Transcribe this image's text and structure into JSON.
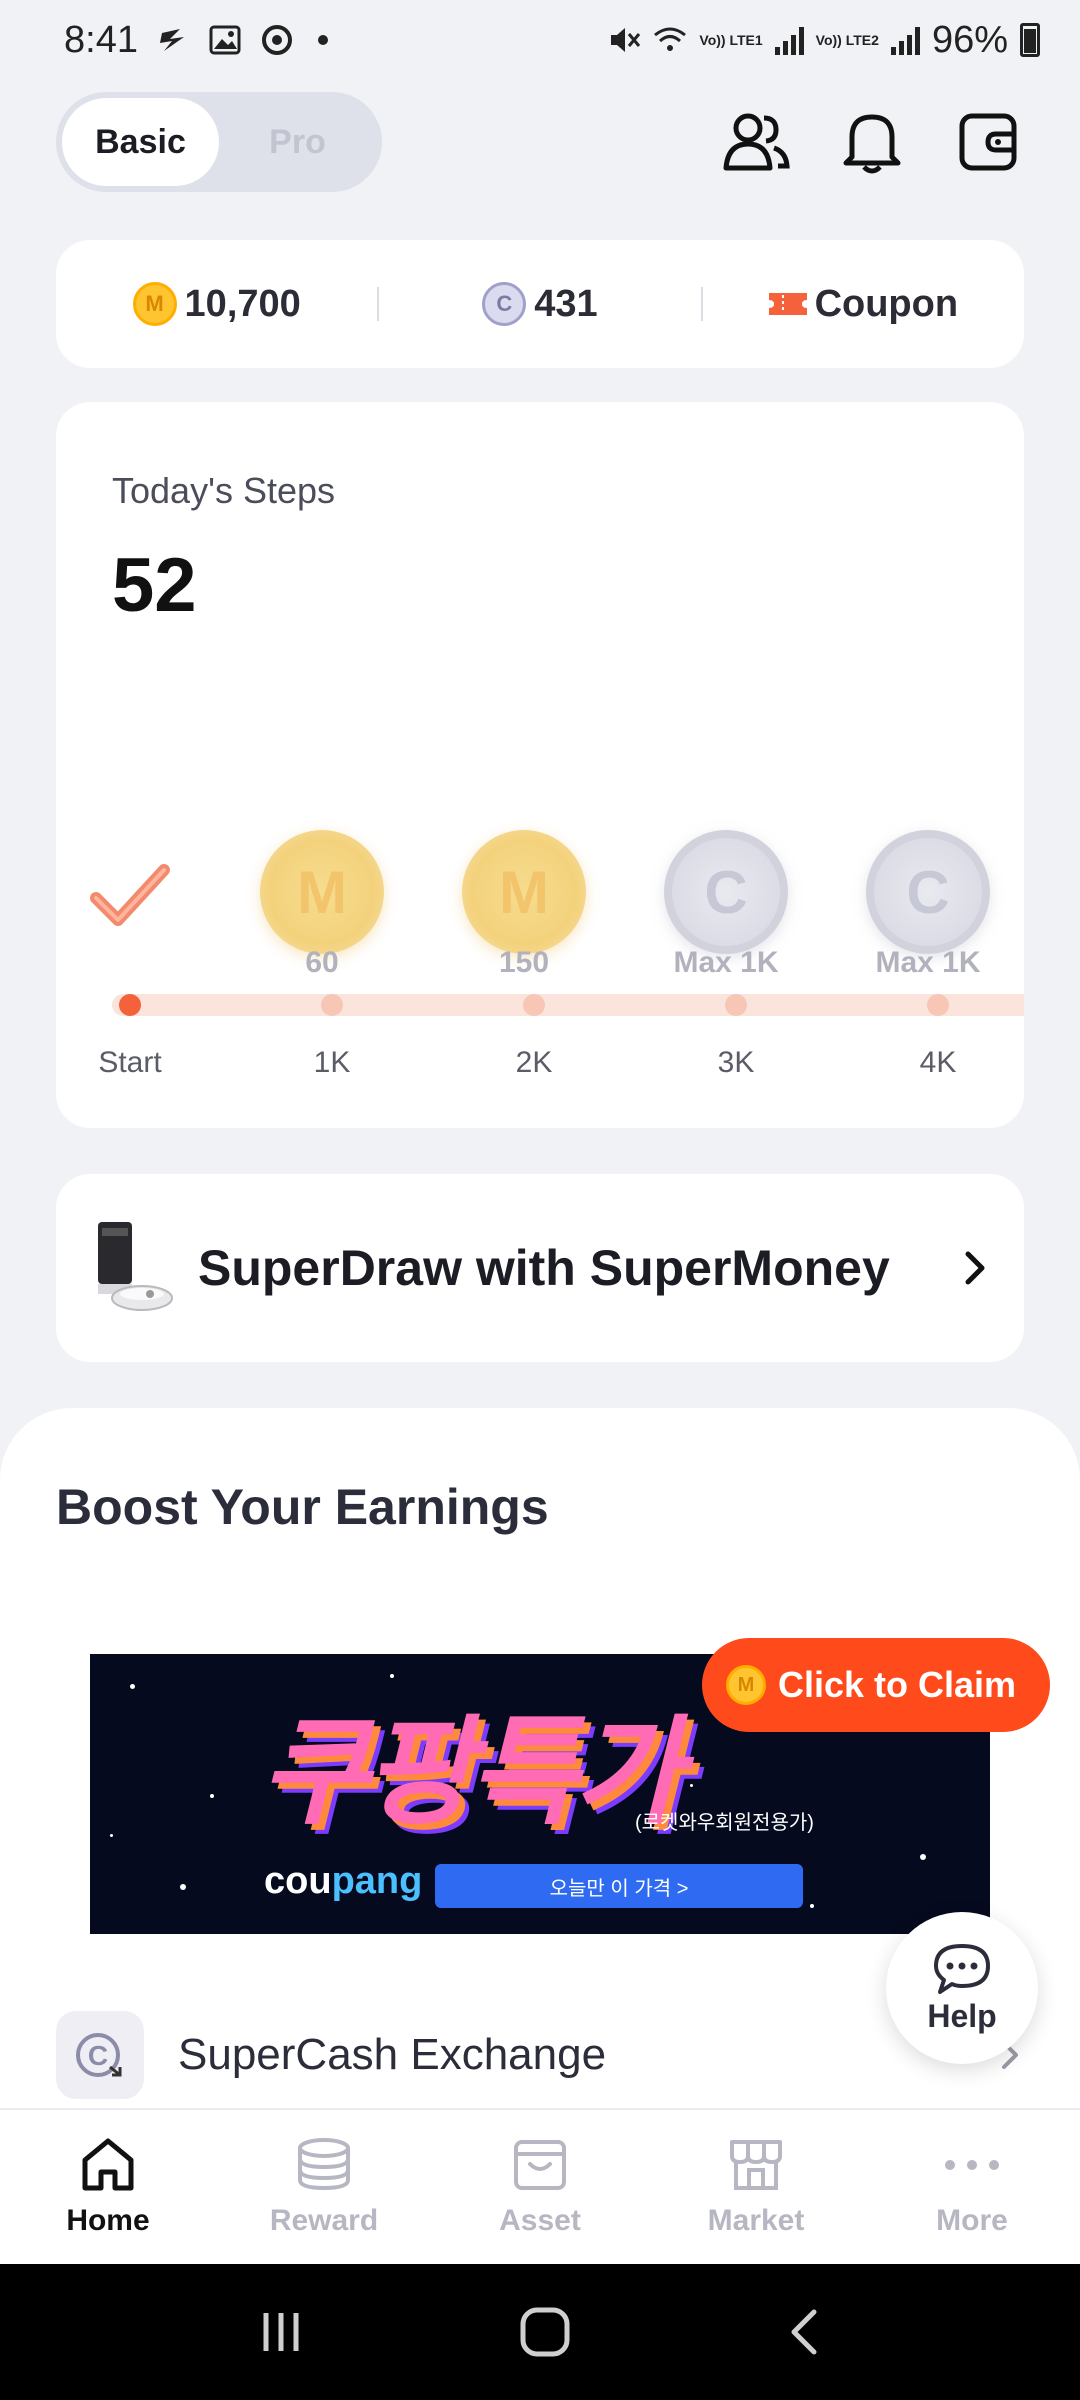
{
  "status_bar": {
    "time": "8:41",
    "battery": "96%",
    "sim1": "Vo)) LTE1",
    "sim2": "Vo)) LTE2"
  },
  "header": {
    "toggle": [
      "Basic",
      "Pro"
    ],
    "active_toggle": "Basic"
  },
  "balance": {
    "supermoney": "10,700",
    "supercash": "431",
    "coupon_label": "Coupon"
  },
  "steps": {
    "label": "Today's Steps",
    "value": "52",
    "progress_fraction": 0.013,
    "milestones": [
      {
        "coin": "M",
        "reward": "60",
        "tick": "1K"
      },
      {
        "coin": "M",
        "reward": "150",
        "tick": "2K"
      },
      {
        "coin": "C",
        "reward": "Max 1K",
        "tick": "3K"
      },
      {
        "coin": "C",
        "reward": "Max 1K",
        "tick": "4K"
      }
    ],
    "start_label": "Start"
  },
  "superdraw": {
    "label": "SuperDraw with SuperMoney"
  },
  "boost": {
    "title": "Boost Your Earnings",
    "claim_label": "Click to Claim",
    "banner": {
      "headline": "쿠팡특가",
      "sub": "(로켓와우회원전용가)",
      "brand_a": "cou",
      "brand_b": "pang",
      "button": "오늘만 이 가격 >"
    },
    "exchange_label": "SuperCash Exchange"
  },
  "help": {
    "label": "Help"
  },
  "nav": {
    "items": [
      {
        "label": "Home",
        "icon": "home-icon",
        "active": true
      },
      {
        "label": "Reward",
        "icon": "coins-stack-icon"
      },
      {
        "label": "Asset",
        "icon": "bag-icon"
      },
      {
        "label": "Market",
        "icon": "store-icon"
      },
      {
        "label": "More",
        "icon": "more-dots-icon"
      }
    ]
  },
  "colors": {
    "accent": "#f5613a",
    "claim": "#ff4a1c",
    "coin_m": "#ffc531",
    "coin_c": "#9fa1c8"
  }
}
